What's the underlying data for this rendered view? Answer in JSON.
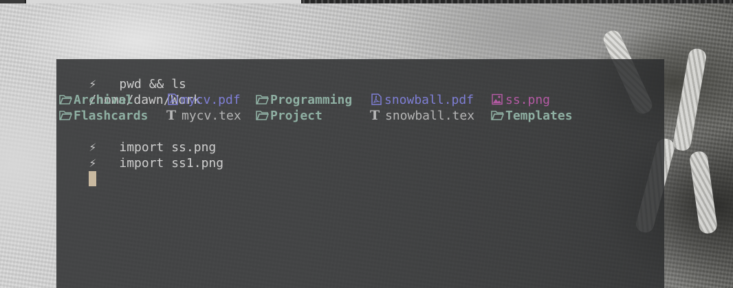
{
  "terminal": {
    "prompt_symbol": "⚡",
    "lines": [
      {
        "command": "pwd && ls"
      },
      {
        "output": "/home/dawn/Work"
      },
      {
        "command_2": "import ss.png"
      },
      {
        "command_3": "import ss1.png"
      }
    ],
    "cmd1": "pwd && ls",
    "pwd_output": "/home/dawn/Work",
    "cmd2": "import ss.png",
    "cmd3": "import ss1.png",
    "listing": {
      "row1": [
        "Archival",
        "mycv.pdf",
        "Programming",
        "snowball.pdf",
        "ss.png"
      ],
      "row2": [
        "Flashcards",
        "mycv.tex",
        "Project",
        "snowball.tex",
        "Templates"
      ]
    },
    "colors": {
      "directory": "#8fb0a3",
      "pdf": "#7f7fd6",
      "tex": "#b6b6b6",
      "image": "#b45aa4",
      "background": "#2d2f30",
      "cursor": "#c9b9a0"
    },
    "icons": {
      "directory": "folder-open-icon",
      "pdf": "pdf-file-icon",
      "tex": "tex-file-icon",
      "image": "image-file-icon"
    }
  }
}
